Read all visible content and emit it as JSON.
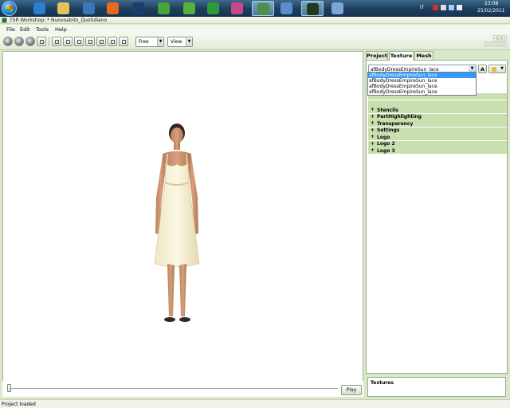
{
  "taskbar": {
    "apps": [
      {
        "icon": "media-center-icon",
        "color": "#2c7fd0"
      },
      {
        "icon": "folder-icon",
        "color": "#e9c15a"
      },
      {
        "icon": "network-icon",
        "color": "#3a77b8"
      },
      {
        "icon": "firefox-icon",
        "color": "#e66a1d"
      },
      {
        "icon": "photoshop-icon",
        "color": "#1b3d6b"
      },
      {
        "icon": "sims-icon",
        "color": "#4aa33a"
      },
      {
        "icon": "sims-icon",
        "color": "#57b13d"
      },
      {
        "icon": "sims-green-icon",
        "color": "#2e9a3b"
      },
      {
        "icon": "puzzle-icon",
        "color": "#c64a8a"
      },
      {
        "icon": "users-icon",
        "color": "#4e8e49"
      },
      {
        "icon": "globe-icon",
        "color": "#5a8ecc"
      },
      {
        "icon": "workshop-icon",
        "color": "#1f3a1f"
      },
      {
        "icon": "paint-icon",
        "color": "#7aa7d6"
      }
    ],
    "tray": {
      "language": "IT",
      "time": "23:08",
      "date": "25/02/2011"
    }
  },
  "window": {
    "title": "TSR Workshop: * Nuovoabito_Quotidiano"
  },
  "menu": {
    "items": [
      "File",
      "Edit",
      "Tools",
      "Help"
    ]
  },
  "toolbar": {
    "camera_mode": "Free",
    "view_label": "View"
  },
  "logo": {
    "line1": "TSR",
    "line2": "Workshop"
  },
  "timeline": {
    "play_label": "Play",
    "position": 0
  },
  "panel": {
    "tabs": [
      "Project",
      "Texture",
      "Mesh"
    ],
    "active_tab": "Texture",
    "texture_select_value": "afBodyDressEmpireSun_lace",
    "a_button_label": "A",
    "dropdown_options": [
      "afBodyDressEmpireSun_lace",
      "afBodyDressEmpireSun_lace",
      "afBodyDressEmpireSun_lace",
      "afBodyDressEmpireSun_lace"
    ],
    "tree_items": [
      "Stencils",
      "PartHighlighting",
      "Transparency",
      "Settings",
      "Logo",
      "Logo 2",
      "Logo 3"
    ],
    "textures_label": "Textures"
  },
  "status": {
    "text": "Project loaded"
  },
  "colors": {
    "accent": "#c9dfb0",
    "selection": "#3399ff"
  }
}
